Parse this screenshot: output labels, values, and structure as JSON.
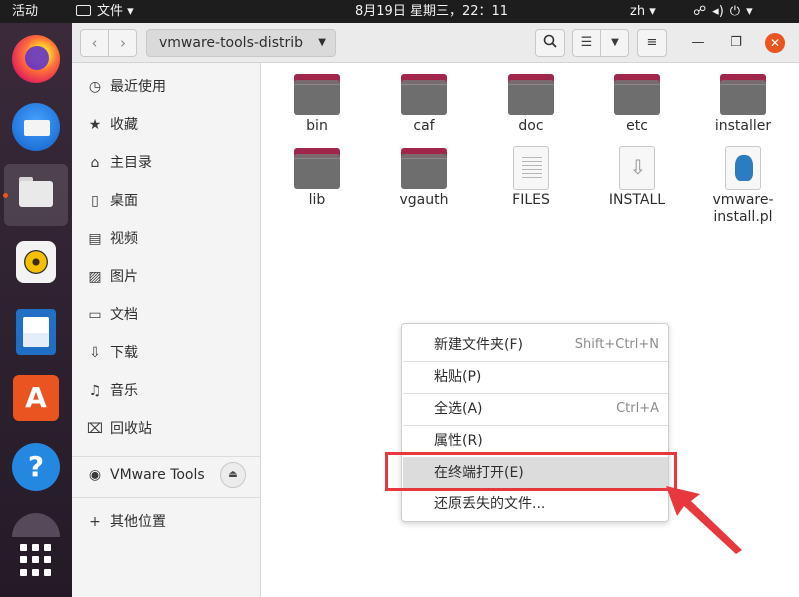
{
  "topbar": {
    "activities": "活动",
    "app_menu": "文件",
    "clock": "8月19日 星期三，22：11",
    "input_method": "zh",
    "tray_icons": [
      "network-icon",
      "volume-icon",
      "power-icon"
    ]
  },
  "dock": {
    "apps": [
      "firefox-icon",
      "thunderbird-icon",
      "files-icon",
      "rhythmbox-icon",
      "libreoffice-writer-icon",
      "software-store-icon",
      "help-icon",
      "app-grid-icon"
    ],
    "active_app": "files-icon",
    "accent": "#e95420"
  },
  "header": {
    "path": "vmware-tools-distrib"
  },
  "sidebar": {
    "places": [
      {
        "icon": "recent-icon",
        "label": "最近使用"
      },
      {
        "icon": "star-icon",
        "label": "收藏"
      },
      {
        "icon": "home-icon",
        "label": "主目录"
      },
      {
        "icon": "desktop-icon",
        "label": "桌面"
      },
      {
        "icon": "video-icon",
        "label": "视频"
      },
      {
        "icon": "picture-icon",
        "label": "图片"
      },
      {
        "icon": "document-icon",
        "label": "文档"
      },
      {
        "icon": "download-icon",
        "label": "下载"
      },
      {
        "icon": "music-icon",
        "label": "音乐"
      },
      {
        "icon": "trash-icon",
        "label": "回收站"
      }
    ],
    "devices": [
      {
        "icon": "disc-icon",
        "label": "VMware Tools"
      }
    ],
    "other": {
      "icon": "plus-icon",
      "label": "其他位置"
    }
  },
  "files": [
    {
      "name": "bin",
      "type": "folder"
    },
    {
      "name": "caf",
      "type": "folder"
    },
    {
      "name": "doc",
      "type": "folder"
    },
    {
      "name": "etc",
      "type": "folder"
    },
    {
      "name": "installer",
      "type": "folder"
    },
    {
      "name": "lib",
      "type": "folder"
    },
    {
      "name": "vgauth",
      "type": "folder"
    },
    {
      "name": "FILES",
      "type": "text"
    },
    {
      "name": "INSTALL",
      "type": "install"
    },
    {
      "name": "vmware-install.pl",
      "display": [
        "vmware-",
        "install.pl"
      ],
      "type": "perl"
    }
  ],
  "context_menu": {
    "items": [
      {
        "label": "新建文件夹(F)",
        "shortcut": "Shift+Ctrl+N"
      },
      {
        "label": "粘贴(P)",
        "shortcut": ""
      },
      {
        "label": "全选(A)",
        "shortcut": "Ctrl+A"
      },
      {
        "label": "属性(R)",
        "shortcut": ""
      },
      {
        "label": "在终端打开(E)",
        "shortcut": "",
        "highlighted": true
      },
      {
        "label": "还原丢失的文件...",
        "shortcut": ""
      }
    ]
  },
  "annotation": {
    "color": "#e8383f",
    "target": "在终端打开(E)"
  }
}
